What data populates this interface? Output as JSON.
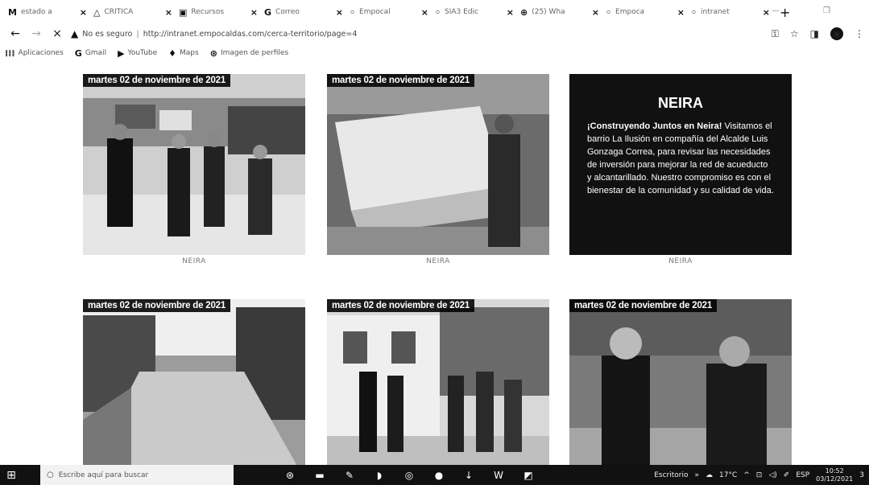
{
  "browser": {
    "tabs": [
      {
        "icon": "M",
        "title": "estado a",
        "close": "×"
      },
      {
        "icon": "△",
        "title": "CRITICA",
        "close": "×"
      },
      {
        "icon": "▣",
        "title": "Recursos",
        "close": "×"
      },
      {
        "icon": "G",
        "title": "Correo",
        "close": "×"
      },
      {
        "icon": "◦",
        "title": "Empocal",
        "close": "×"
      },
      {
        "icon": "◦",
        "title": "SIA3 Edic",
        "close": "×"
      },
      {
        "icon": "⊕",
        "title": "(25) Wha",
        "close": "×"
      },
      {
        "icon": "◦",
        "title": "Empoca",
        "close": "×"
      },
      {
        "icon": "◦",
        "title": "intranet",
        "close": "×"
      }
    ],
    "new_tab": "+",
    "nav": {
      "back": "←",
      "forward": "→",
      "close": "×"
    },
    "security_warning_icon": "▲",
    "security_label": "No es seguro",
    "url_separator": "|",
    "url": "http://intranet.empocaldas.com/cerca-territorio/page=4",
    "bookmarks": [
      {
        "icon": "⁞⁞⁞",
        "label": "Aplicaciones"
      },
      {
        "icon": "G",
        "label": "Gmail"
      },
      {
        "icon": "▶",
        "label": "YouTube"
      },
      {
        "icon": "♦",
        "label": "Maps"
      },
      {
        "icon": "⊛",
        "label": "Imagen de perfiles"
      }
    ]
  },
  "cards": [
    {
      "date": "martes 02 de noviembre de 2021",
      "caption": "NEIRA"
    },
    {
      "date": "martes 02 de noviembre de 2021",
      "caption": "NEIRA"
    },
    {
      "title": "NEIRA",
      "lead": "¡Construyendo Juntos en Neira!",
      "body": "Visitamos el barrio La Ilusión en compañía del Alcalde Luis Gonzaga Correa, para revisar las necesidades de inversión para mejorar la red de acueducto y alcantarillado. Nuestro compromiso es con el bienestar de la comunidad y su calidad de vida.",
      "caption": "NEIRA"
    },
    {
      "date": "martes 02 de noviembre de 2021"
    },
    {
      "date": "martes 02 de noviembre de 2021"
    },
    {
      "date": "martes 02 de noviembre de 2021"
    }
  ],
  "taskbar": {
    "search_placeholder": "Escribe aquí para buscar",
    "desktop_label": "Escritorio",
    "weather": "17°C",
    "language": "ESP",
    "time": "10:52",
    "date": "03/12/2021",
    "notifications": "3"
  }
}
